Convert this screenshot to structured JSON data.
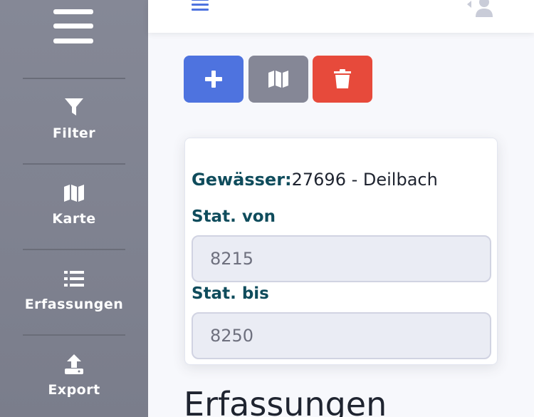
{
  "sidebar": {
    "items": [
      {
        "label": "Filter",
        "icon": "filter-icon"
      },
      {
        "label": "Karte",
        "icon": "map-icon"
      },
      {
        "label": "Erfassungen",
        "icon": "list-icon"
      },
      {
        "label": "Export",
        "icon": "upload-icon"
      }
    ]
  },
  "toolbar": {
    "buttons": [
      {
        "icon": "plus-icon",
        "color": "#4e73df"
      },
      {
        "icon": "map-icon",
        "color": "#858796"
      },
      {
        "icon": "trash-icon",
        "color": "#e74a3b"
      }
    ]
  },
  "card": {
    "gewaesser_label": "Gewässer:",
    "gewaesser_value": "27696 - Deilbach",
    "stat_von_label": "Stat. von",
    "stat_von_value": "8215",
    "stat_bis_label": "Stat. bis",
    "stat_bis_value": "8250"
  },
  "main": {
    "section_title": "Erfassungen"
  },
  "colors": {
    "primary": "#4e73df",
    "secondary": "#858796",
    "danger": "#e74a3b",
    "label": "#0f4c5c"
  }
}
